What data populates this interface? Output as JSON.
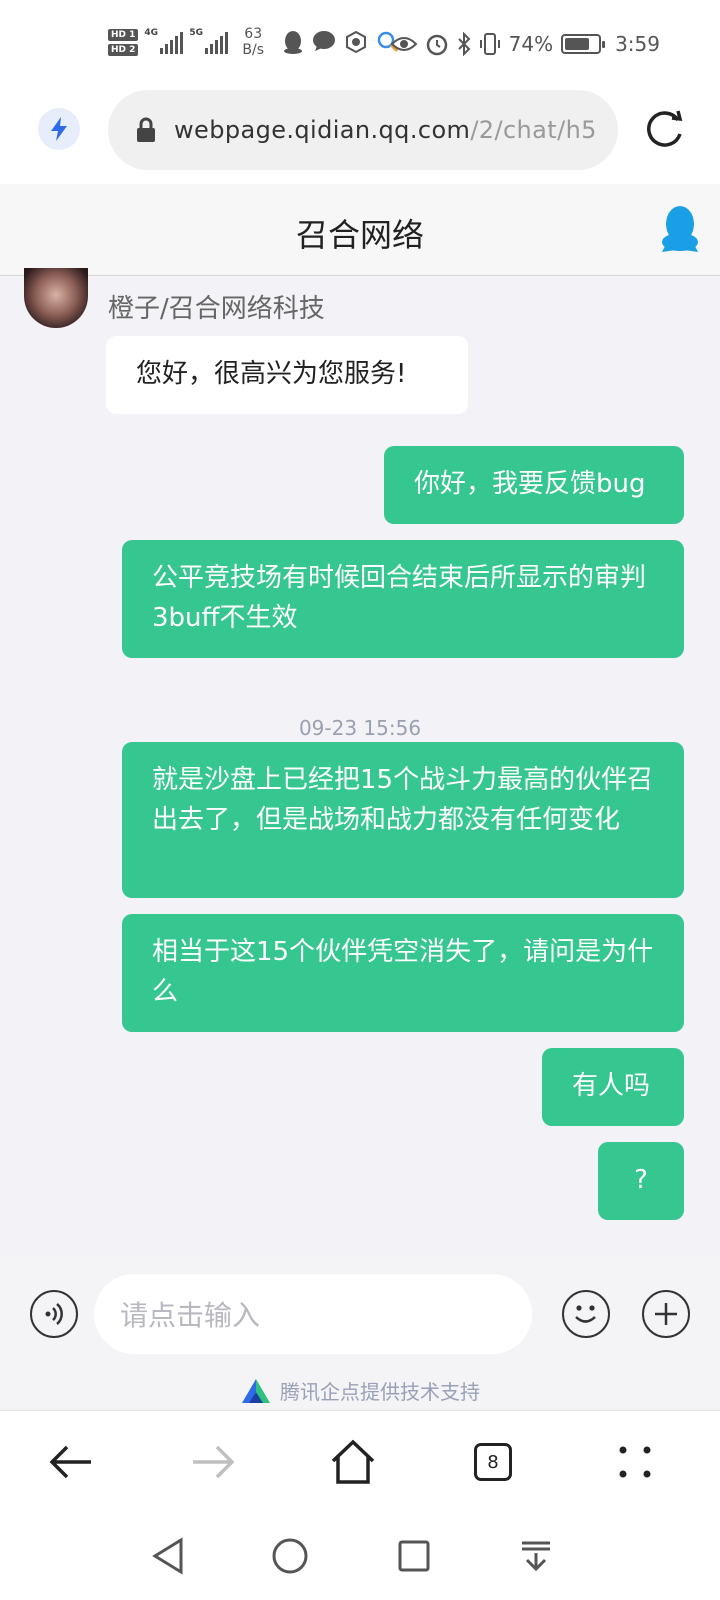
{
  "status_bar": {
    "hd1": "HD 1",
    "hd2": "HD 2",
    "net1": "4G",
    "net2": "5G",
    "speed_value": "63",
    "speed_unit": "B/s",
    "battery_percent": "74%",
    "battery_level": 0.74,
    "time": "3:59"
  },
  "browser": {
    "url_host": "webpage.qidian.qq.com",
    "url_path": "/2/chat/h5",
    "tab_count": "8"
  },
  "chat": {
    "title": "召合网络",
    "agent_name": "橙子/召合网络科技",
    "greeting": "您好，很高兴为您服务!",
    "messages": [
      "你好，我要反馈bug",
      "公平竞技场有时候回合结束后所显示的审判3buff不生效",
      "就是沙盘上已经把15个战斗力最高的伙伴召出去了，但是战场和战力都没有任何变化",
      "相当于这15个伙伴凭空消失了，请问是为什么",
      "有人吗",
      "?"
    ],
    "timestamp": "09-23 15:56"
  },
  "composer": {
    "placeholder": "请点击输入",
    "powered_by": "腾讯企点提供技术支持"
  },
  "colors": {
    "outgoing_bubble": "#35c78f",
    "qq_blue": "#1a9fe6",
    "bolt_blue": "#2f6ae8"
  }
}
